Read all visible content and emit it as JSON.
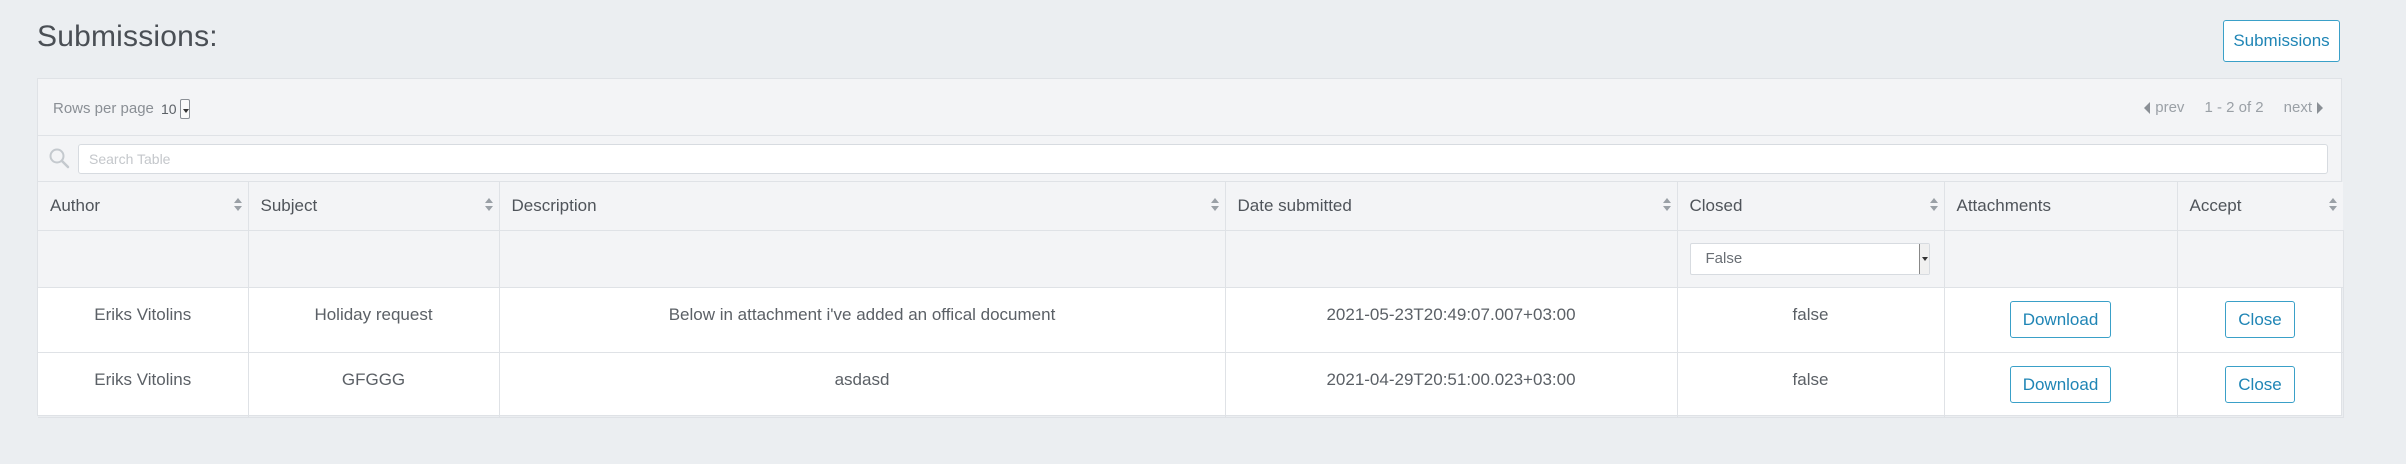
{
  "page": {
    "title": "Submissions:"
  },
  "header": {
    "submissions_button": "Submissions"
  },
  "table_footer": {
    "rows_per_page_label": "Rows per page",
    "rows_per_page_value": "10",
    "prev_label": "prev",
    "range_label": "1 - 2 of 2",
    "next_label": "next"
  },
  "search": {
    "placeholder": "Search Table"
  },
  "columns": [
    "Author",
    "Subject",
    "Description",
    "Date submitted",
    "Closed",
    "Attachments",
    "Accept"
  ],
  "filters": {
    "closed_value": "False"
  },
  "rows": [
    {
      "author": "Eriks Vitolins",
      "subject": "Holiday request",
      "description": "Below in attachment i've added an offical document",
      "date": "2021-05-23T20:49:07.007+03:00",
      "closed": "false",
      "attachment_button": "Download",
      "accept_button": "Close"
    },
    {
      "author": "Eriks Vitolins",
      "subject": "GFGGG",
      "description": "asdasd",
      "date": "2021-04-29T20:51:00.023+03:00",
      "closed": "false",
      "attachment_button": "Download",
      "accept_button": "Close"
    }
  ],
  "colors": {
    "accent": "#1f85b5",
    "background": "#ebeef1",
    "header_bg": "#f3f4f6"
  }
}
